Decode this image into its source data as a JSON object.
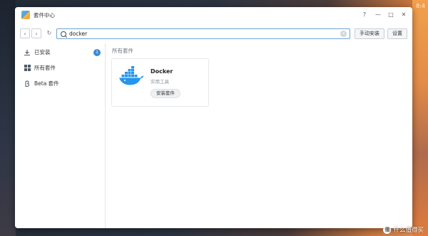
{
  "window": {
    "title": "套件中心"
  },
  "window_controls": {
    "help": "?",
    "minimize": "—",
    "maximize": "□",
    "close": "✕"
  },
  "toolbar": {
    "back": "‹",
    "forward": "›",
    "refresh": "↻",
    "search_value": "docker",
    "clear": "✕",
    "manual_install": "手动安装",
    "settings": "设置"
  },
  "sidebar": {
    "items": [
      {
        "label": "已安装",
        "badge": "1",
        "icon": "download-icon"
      },
      {
        "label": "所有套件",
        "icon": "grid-icon"
      },
      {
        "label": "Beta 套件",
        "icon": "beta-icon"
      }
    ]
  },
  "main": {
    "section_title": "所有套件",
    "packages": [
      {
        "name": "Docker",
        "category": "实用工具",
        "action": "安装套件",
        "icon": "docker-icon"
      }
    ]
  },
  "desktop": {
    "corner_text": "8:4",
    "watermark": "什么值得买",
    "watermark_badge": "值"
  },
  "colors": {
    "accent": "#3a8bd1",
    "docker_blue": "#2496ed"
  }
}
